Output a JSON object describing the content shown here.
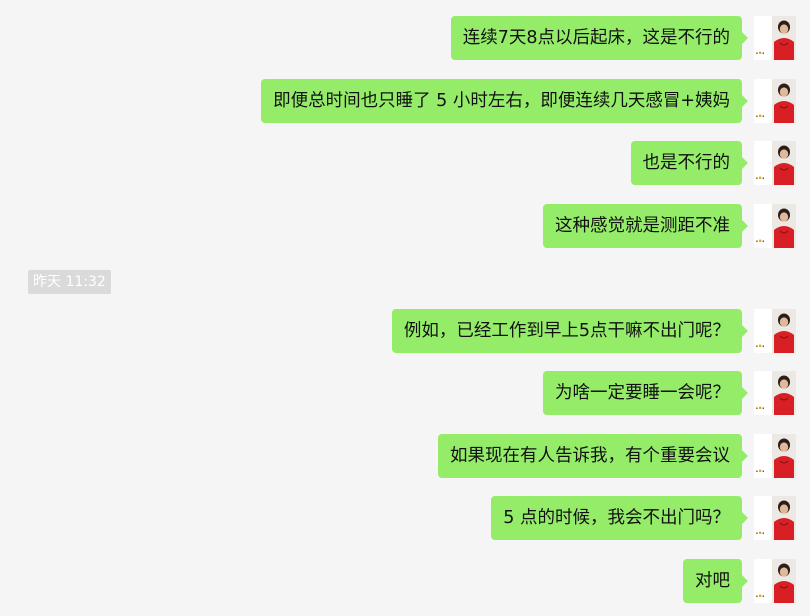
{
  "chat": {
    "timestamp_label": "昨天 11:32",
    "messages": [
      {
        "text": "连续7天8点以后起床，这是不行的",
        "sender": "self"
      },
      {
        "text": "即便总时间也只睡了 5 小时左右，即便连续几天感冒+姨妈",
        "sender": "self"
      },
      {
        "text": "也是不行的",
        "sender": "self"
      },
      {
        "text": "这种感觉就是测距不准",
        "sender": "self"
      },
      {
        "text": "例如，已经工作到早上5点干嘛不出门呢？",
        "sender": "self"
      },
      {
        "text": "为啥一定要睡一会呢？",
        "sender": "self"
      },
      {
        "text": "如果现在有人告诉我，有个重要会议",
        "sender": "self"
      },
      {
        "text": "5 点的时候，我会不出门吗？",
        "sender": "self"
      },
      {
        "text": "对吧",
        "sender": "self"
      }
    ]
  },
  "colors": {
    "background": "#f5f5f5",
    "bubble_self": "#95ec69",
    "timestamp_bg": "#dadada",
    "timestamp_text": "#ffffff",
    "avatar_shirt": "#d91f26"
  },
  "icons": {
    "avatar": "user-avatar-photo",
    "status": "loading-dots"
  }
}
